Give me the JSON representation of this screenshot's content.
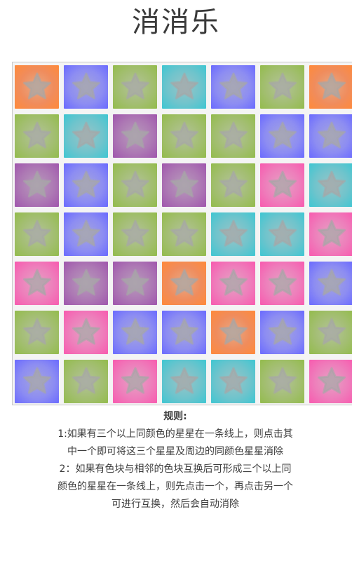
{
  "title": "消消乐",
  "colors": {
    "orange": "#ff8a3a",
    "blue": "#6a6aff",
    "green": "#93bc4c",
    "teal": "#3ec6d2",
    "purple": "#a056ad",
    "pink": "#f85aaf",
    "star": "#a7a7a7"
  },
  "tile_icon": "star-icon",
  "board": [
    [
      "orange",
      "blue",
      "green",
      "teal",
      "blue",
      "green",
      "orange"
    ],
    [
      "green",
      "teal",
      "purple",
      "green",
      "green",
      "blue",
      "blue"
    ],
    [
      "purple",
      "blue",
      "green",
      "purple",
      "green",
      "pink",
      "teal"
    ],
    [
      "green",
      "blue",
      "green",
      "green",
      "teal",
      "teal",
      "pink"
    ],
    [
      "pink",
      "purple",
      "purple",
      "orange",
      "pink",
      "pink",
      "blue"
    ],
    [
      "green",
      "pink",
      "blue",
      "blue",
      "orange",
      "blue",
      "green"
    ],
    [
      "blue",
      "green",
      "pink",
      "teal",
      "teal",
      "green",
      "pink"
    ]
  ],
  "rules": {
    "heading": "规则:",
    "rule1": "1:如果有三个以上同颜色的星星在一条线上，则点击其中一个即可将这三个星星及周边的同颜色星星消除",
    "rule2": "2：如果有色块与相邻的色块互换后可形成三个以上同颜色的星星在一条线上，则先点击一个，再点击另一个可进行互换，然后会自动消除"
  }
}
